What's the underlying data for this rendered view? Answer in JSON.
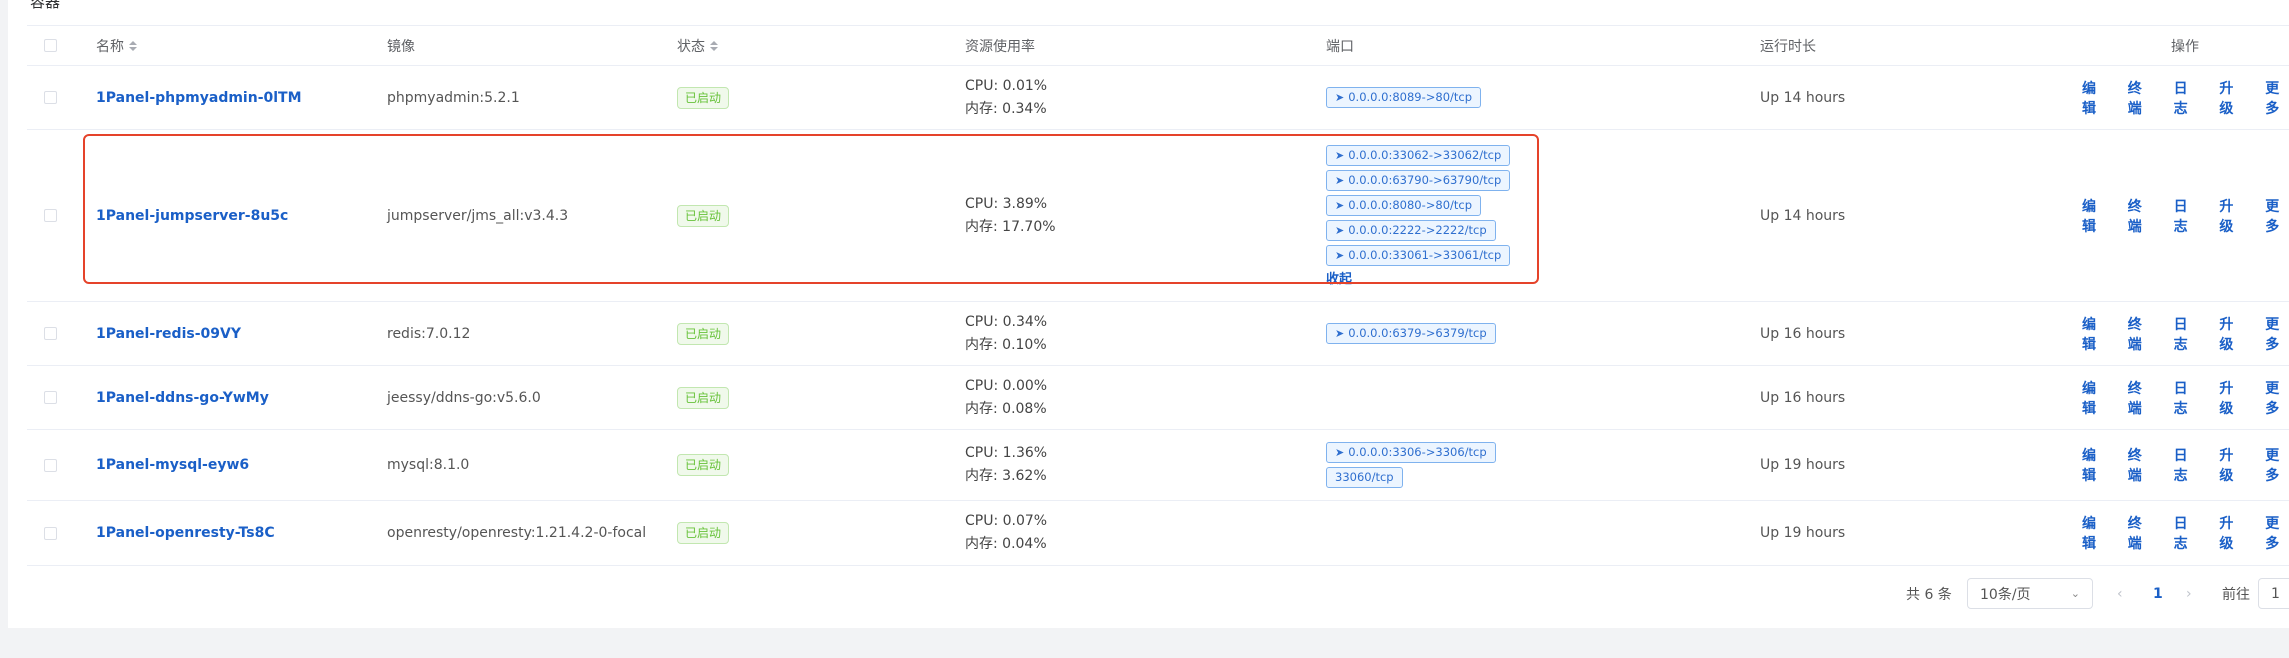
{
  "page_title_partial": "容器",
  "table": {
    "columns": {
      "name": "名称",
      "image": "镜像",
      "status": "状态",
      "resources": "资源使用率",
      "ports": "端口",
      "uptime": "运行时长",
      "actions": "操作"
    },
    "rows": [
      {
        "name": "1Panel-phpmyadmin-0lTM",
        "image": "phpmyadmin:5.2.1",
        "status": "已启动",
        "cpu": "CPU: 0.01%",
        "mem": "内存: 0.34%",
        "ports": [
          "0.0.0.0:8089->80/tcp"
        ],
        "uptime": "Up 14 hours"
      },
      {
        "name": "1Panel-jumpserver-8u5c",
        "image": "jumpserver/jms_all:v3.4.3",
        "status": "已启动",
        "cpu": "CPU: 3.89%",
        "mem": "内存: 17.70%",
        "ports": [
          "0.0.0.0:33062->33062/tcp",
          "0.0.0.0:63790->63790/tcp",
          "0.0.0.0:8080->80/tcp",
          "0.0.0.0:2222->2222/tcp",
          "0.0.0.0:33061->33061/tcp"
        ],
        "collapse_label": "收起",
        "uptime": "Up 14 hours"
      },
      {
        "name": "1Panel-redis-09VY",
        "image": "redis:7.0.12",
        "status": "已启动",
        "cpu": "CPU: 0.34%",
        "mem": "内存: 0.10%",
        "ports": [
          "0.0.0.0:6379->6379/tcp"
        ],
        "uptime": "Up 16 hours"
      },
      {
        "name": "1Panel-ddns-go-YwMy",
        "image": "jeessy/ddns-go:v5.6.0",
        "status": "已启动",
        "cpu": "CPU: 0.00%",
        "mem": "内存: 0.08%",
        "ports": [],
        "uptime": "Up 16 hours"
      },
      {
        "name": "1Panel-mysql-eyw6",
        "image": "mysql:8.1.0",
        "status": "已启动",
        "cpu": "CPU: 1.36%",
        "mem": "内存: 3.62%",
        "ports": [
          "0.0.0.0:3306->3306/tcp",
          "33060/tcp"
        ],
        "uptime": "Up 19 hours"
      },
      {
        "name": "1Panel-openresty-Ts8C",
        "image": "openresty/openresty:1.21.4.2-0-focal",
        "status": "已启动",
        "cpu": "CPU: 0.07%",
        "mem": "内存: 0.04%",
        "ports": [],
        "uptime": "Up 19 hours"
      }
    ],
    "actions": [
      "编辑",
      "终端",
      "日志",
      "升级",
      "更多"
    ]
  },
  "pagination": {
    "total": "共 6 条",
    "page_size": "10条/页",
    "current_page": "1",
    "goto_label": "前往",
    "goto_value": "1"
  },
  "colors": {
    "link": "#1a5fc7",
    "status_green": "#67c23a",
    "highlight_border": "#e5432a"
  }
}
